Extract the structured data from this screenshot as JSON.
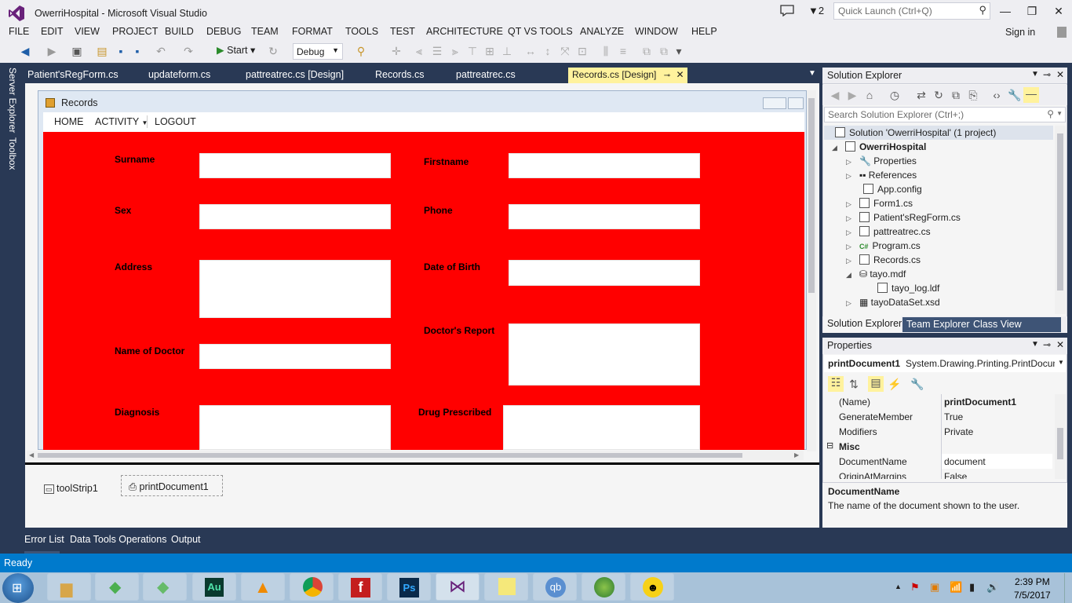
{
  "title": {
    "text": "OwerriHospital - Microsoft Visual Studio",
    "notifications": "2",
    "quick_launch_placeholder": "Quick Launch (Ctrl+Q)"
  },
  "menu": [
    "FILE",
    "EDIT",
    "VIEW",
    "PROJECT",
    "BUILD",
    "DEBUG",
    "TEAM",
    "FORMAT",
    "TOOLS",
    "TEST",
    "ARCHITECTURE",
    "QT VS TOOLS",
    "ANALYZE",
    "WINDOW",
    "HELP"
  ],
  "signin": "Sign in",
  "toolbar": {
    "start": "Start",
    "config": "Debug"
  },
  "left_tabs": [
    "Server Explorer",
    "Toolbox"
  ],
  "doc_tabs": [
    "Patient'sRegForm.cs",
    "updateform.cs",
    "pattreatrec.cs [Design]",
    "Records.cs",
    "pattreatrec.cs",
    "Records.cs [Design]"
  ],
  "form": {
    "title": "Records",
    "menu": [
      "HOME",
      "ACTIVITY",
      "LOGOUT"
    ],
    "labels": {
      "surname": "Surname",
      "firstname": "Firstname",
      "sex": "Sex",
      "phone": "Phone",
      "address": "Address",
      "dob": "Date of Birth",
      "doctors_report": "Doctor's Report",
      "name_of_doctor": "Name of Doctor",
      "diagnosis": "Diagnosis",
      "drug_prescribed": "Drug Prescribed"
    }
  },
  "tray": [
    "toolStrip1",
    "printDocument1"
  ],
  "bottom_tabs": [
    "Error List",
    "Data Tools Operations",
    "Output"
  ],
  "status": "Ready",
  "solution_explorer": {
    "title": "Solution Explorer",
    "search": "Search Solution Explorer (Ctrl+;)",
    "solution": "Solution 'OwerriHospital' (1 project)",
    "project": "OwerriHospital",
    "items": [
      "Properties",
      "References",
      "App.config",
      "Form1.cs",
      "Patient'sRegForm.cs",
      "pattreatrec.cs",
      "Program.cs",
      "Records.cs",
      "tayo.mdf",
      "tayo_log.ldf",
      "tayoDataSet.xsd"
    ],
    "tabs": [
      "Solution Explorer",
      "Team Explorer",
      "Class View"
    ]
  },
  "properties": {
    "title": "Properties",
    "object": "printDocument1",
    "type": "System.Drawing.Printing.PrintDocum",
    "rows": [
      {
        "name": "(Name)",
        "value": "printDocument1"
      },
      {
        "name": "GenerateMember",
        "value": "True"
      },
      {
        "name": "Modifiers",
        "value": "Private"
      },
      {
        "name": "DocumentName",
        "value": "document"
      },
      {
        "name": "OriginAtMargins",
        "value": "False"
      }
    ],
    "category": "Misc",
    "desc_title": "DocumentName",
    "desc_text": "The name of the document shown to the user."
  },
  "clock": {
    "time": "2:39 PM",
    "date": "7/5/2017"
  }
}
